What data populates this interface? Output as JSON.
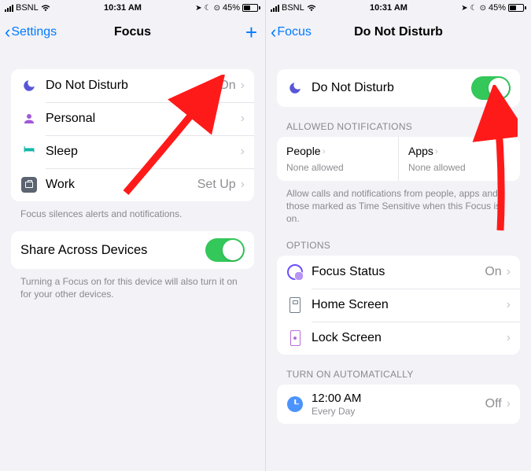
{
  "status": {
    "carrier": "BSNL",
    "time": "10:31 AM",
    "battery_pct": "45%"
  },
  "left": {
    "back_label": "Settings",
    "title": "Focus",
    "rows": {
      "dnd": {
        "label": "Do Not Disturb",
        "detail": "On"
      },
      "personal": {
        "label": "Personal"
      },
      "sleep": {
        "label": "Sleep"
      },
      "work": {
        "label": "Work",
        "detail": "Set Up"
      }
    },
    "footer1": "Focus silences alerts and notifications.",
    "share_row": "Share Across Devices",
    "footer2": "Turning a Focus on for this device will also turn it on for your other devices."
  },
  "right": {
    "back_label": "Focus",
    "title": "Do Not Disturb",
    "dnd_row": "Do Not Disturb",
    "allowed_header": "ALLOWED NOTIFICATIONS",
    "people": {
      "title": "People",
      "sub": "None allowed"
    },
    "apps": {
      "title": "Apps",
      "sub": "None allowed"
    },
    "allowed_footer": "Allow calls and notifications from people, apps and those marked as Time Sensitive when this Focus is on.",
    "options_header": "OPTIONS",
    "options": {
      "focus_status": {
        "label": "Focus Status",
        "detail": "On"
      },
      "home_screen": {
        "label": "Home Screen"
      },
      "lock_screen": {
        "label": "Lock Screen"
      }
    },
    "auto_header": "TURN ON AUTOMATICALLY",
    "auto_row": {
      "label": "12:00 AM",
      "sub": "Every Day",
      "detail": "Off"
    }
  }
}
